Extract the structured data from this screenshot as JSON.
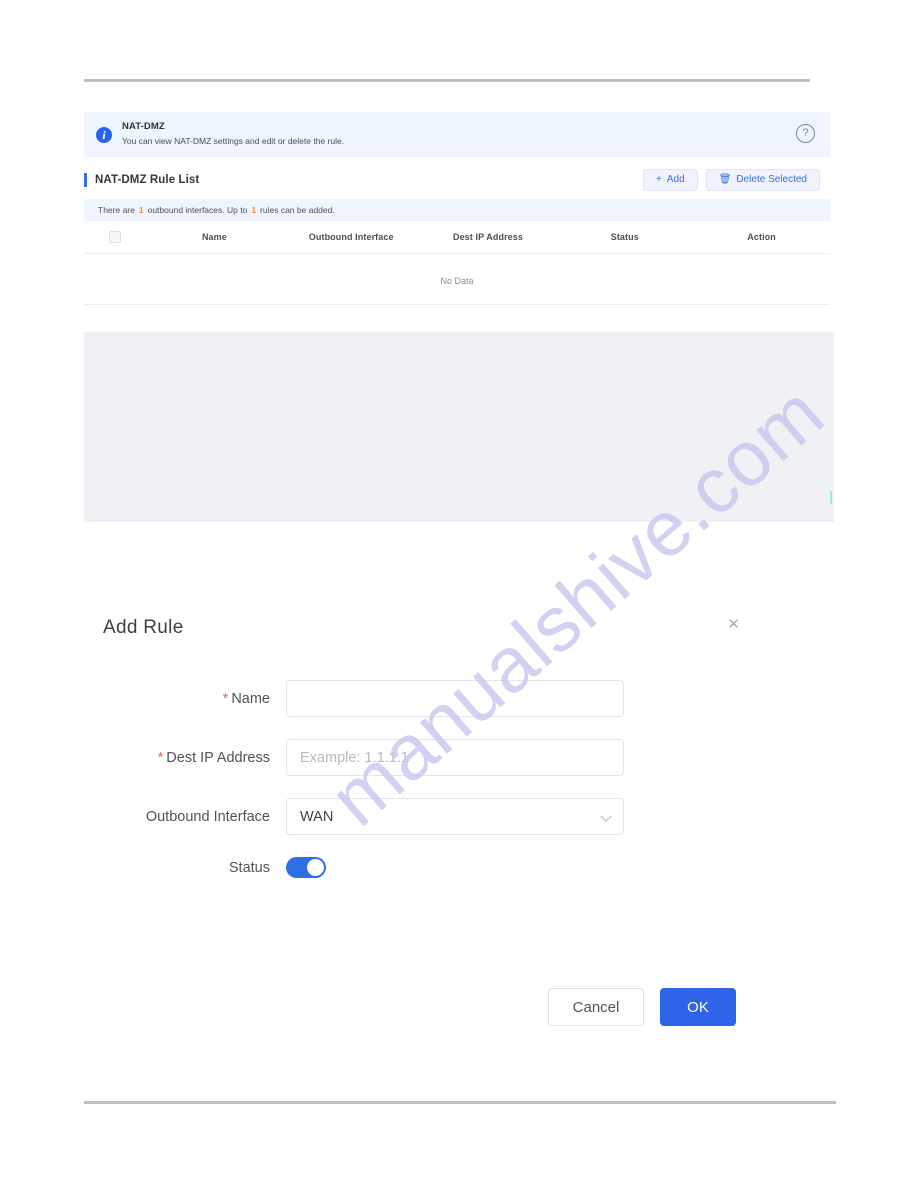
{
  "banner": {
    "icon": "info-icon",
    "title": "NAT-DMZ",
    "description": "You can view NAT-DMZ settings and edit or delete the rule.",
    "help_icon": "help-circle-icon",
    "help_glyph": "?",
    "background": "#eef5fe",
    "icon_color": "#2563eb"
  },
  "card": {
    "title": "NAT-DMZ Rule List",
    "accent_color": "#2f6fe4",
    "add_button": {
      "label": "Add",
      "glyph": "+"
    },
    "delete_button": {
      "label": "Delete Selected",
      "glyph": "Ὕ1"
    },
    "tip": {
      "prefix": "There are",
      "count_interfaces": "1",
      "middle": "outbound interfaces. Up to",
      "count_rules": "1",
      "suffix": "rules can be added.",
      "number_color": "#f28c2e"
    },
    "table": {
      "columns": [
        "Name",
        "Outbound Interface",
        "Dest IP Address",
        "Status",
        "Action"
      ],
      "rows": [],
      "empty_text": "No Data"
    }
  },
  "dialog": {
    "title": "Add Rule",
    "close_glyph": "✕",
    "fields": {
      "name": {
        "label": "Name",
        "required": true,
        "value": "",
        "placeholder": ""
      },
      "dest_ip": {
        "label": "Dest IP Address",
        "required": true,
        "value": "",
        "placeholder": "Example: 1.1.1.1"
      },
      "outbound_interface": {
        "label": "Outbound Interface",
        "required": false,
        "value": "WAN",
        "options": [
          "WAN"
        ]
      },
      "status": {
        "label": "Status",
        "enabled": true,
        "on_color": "#2f6fe4"
      }
    },
    "buttons": {
      "cancel": "Cancel",
      "ok": "OK",
      "ok_color": "#2f63e8"
    }
  },
  "watermark": {
    "text": "manualshive.com",
    "color": "#c9c9ef"
  }
}
